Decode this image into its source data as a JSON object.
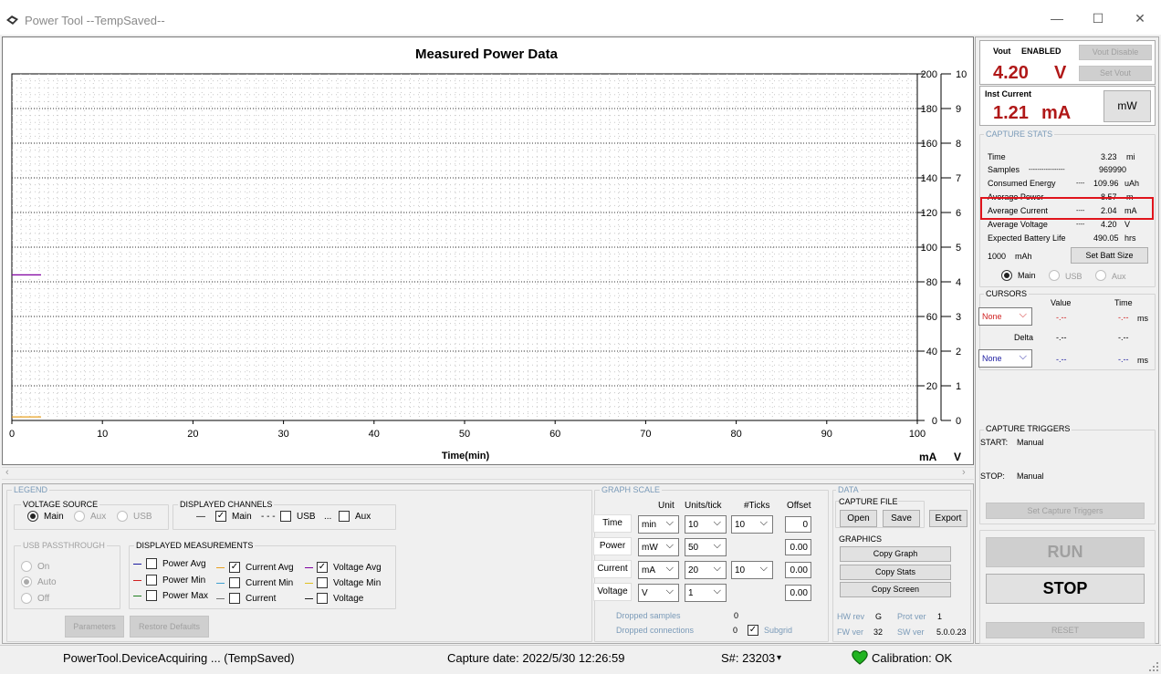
{
  "window": {
    "title": "Power Tool --TempSaved--",
    "minimize": "—",
    "maximize": "☐",
    "close": "✕"
  },
  "chart_data": {
    "type": "line",
    "title": "Measured Power Data",
    "xlabel": "Time(min)",
    "xlim": [
      0,
      100
    ],
    "x_ticks": [
      "0",
      "10",
      "20",
      "30",
      "40",
      "50",
      "60",
      "70",
      "80",
      "90",
      "100"
    ],
    "y_left_unit": "mA",
    "y_left_ylim": [
      0,
      200
    ],
    "y_left_ticks": [
      "0",
      "20",
      "40",
      "60",
      "80",
      "100",
      "120",
      "140",
      "160",
      "180",
      "200"
    ],
    "y_right_unit": "V",
    "y_right_ylim": [
      0,
      10
    ],
    "y_right_ticks": [
      "0",
      "1",
      "2",
      "3",
      "4",
      "5",
      "6",
      "7",
      "8",
      "9",
      "10"
    ],
    "grid": true,
    "series": [
      {
        "color": "#8000a0",
        "axis": "right",
        "x": [
          0,
          3.23
        ],
        "y": [
          4.2,
          4.2
        ]
      },
      {
        "color": "#e8a020",
        "axis": "left",
        "x": [
          0,
          3.23
        ],
        "y": [
          2.04,
          2.04
        ]
      }
    ]
  },
  "legend": {
    "title": "LEGEND",
    "voltage_source": {
      "title": "VOLTAGE SOURCE",
      "options": [
        "Main",
        "Aux",
        "USB"
      ],
      "selected": "Main"
    },
    "displayed_channels": {
      "title": "DISPLAYED CHANNELS",
      "main_line": "—",
      "main": "Main",
      "usb_line": "- - -",
      "usb": "USB",
      "aux_line": "...",
      "aux": "Aux"
    },
    "usb_passthrough": {
      "title": "USB PASSTHROUGH",
      "options": [
        "On",
        "Auto",
        "Off"
      ],
      "selected": "Auto"
    },
    "displayed_measurements": {
      "title": "DISPLAYED MEASUREMENTS",
      "power_avg": "Power Avg",
      "power_min": "Power Min",
      "power_max": "Power Max",
      "current_avg": "Current Avg",
      "current_min": "Current Min",
      "current": "Current",
      "voltage_avg": "Voltage Avg",
      "voltage_min": "Voltage Min",
      "voltage": "Voltage"
    },
    "parameters": "Parameters",
    "restore_defaults": "Restore Defaults"
  },
  "graph_scale": {
    "title": "GRAPH SCALE",
    "headers": {
      "unit": "Unit",
      "units_tick": "Units/tick",
      "ticks": "#Ticks",
      "offset": "Offset"
    },
    "rows": [
      {
        "label": "Time",
        "unit": "min",
        "units_tick": "10",
        "ticks": "10",
        "offset": "0"
      },
      {
        "label": "Power",
        "unit": "mW",
        "units_tick": "50",
        "ticks": "",
        "offset": "0.00"
      },
      {
        "label": "Current",
        "unit": "mA",
        "units_tick": "20",
        "ticks": "10",
        "offset": "0.00"
      },
      {
        "label": "Voltage",
        "unit": "V",
        "units_tick": "1",
        "ticks": "",
        "offset": "0.00"
      }
    ],
    "dropped_samples_label": "Dropped samples",
    "dropped_samples": "0",
    "dropped_connections_label": "Dropped connections",
    "dropped_connections": "0",
    "subgrid": "Subgrid"
  },
  "data": {
    "title": "DATA",
    "capture_file": "CAPTURE FILE",
    "open": "Open",
    "save": "Save",
    "export": "Export",
    "graphics": "GRAPHICS",
    "copy_graph": "Copy Graph",
    "copy_stats": "Copy Stats",
    "copy_screen": "Copy Screen",
    "hw_rev_label": "HW rev",
    "hw_rev": "G",
    "prot_ver_label": "Prot ver",
    "prot_ver": "1",
    "fw_ver_label": "FW ver",
    "fw_ver": "32",
    "sw_ver_label": "SW ver",
    "sw_ver": "5.0.0.23"
  },
  "vout": {
    "label": "Vout",
    "status": "ENABLED",
    "value": "4.20",
    "unit": "V",
    "disable_btn": "Vout Disable",
    "set_btn": "Set Vout"
  },
  "inst_current": {
    "label": "Inst Current",
    "value": "1.21",
    "unit": "mA",
    "toggle": "mW"
  },
  "capture_stats": {
    "title": "CAPTURE STATS",
    "rows": [
      {
        "label": "Time",
        "dots": "",
        "value": "3.23",
        "unit": "mi"
      },
      {
        "label": "Samples",
        "dots": "-----------------",
        "value": "969990",
        "unit": ""
      },
      {
        "label": "Consumed Energy",
        "dots": "----",
        "value": "109.96",
        "unit": "uAh"
      },
      {
        "label": "Average Power",
        "dots": "",
        "value": "8.57",
        "unit": "m"
      },
      {
        "label": "Average Current",
        "dots": "----",
        "value": "2.04",
        "unit": "mA"
      },
      {
        "label": "Average Voltage",
        "dots": "----",
        "value": "4.20",
        "unit": "V"
      },
      {
        "label": "Expected Battery Life",
        "dots": "",
        "value": "490.05",
        "unit": "hrs"
      }
    ],
    "batt_size": "1000",
    "batt_unit": "mAh",
    "set_batt": "Set Batt Size",
    "channels": [
      "Main",
      "USB",
      "Aux"
    ]
  },
  "cursors": {
    "title": "CURSORS",
    "value_header": "Value",
    "time_header": "Time",
    "c1": {
      "select": "None",
      "value": "-.--",
      "time": "-.--",
      "unit": "ms"
    },
    "delta": {
      "label": "Delta",
      "value": "-.--",
      "time": "-.--"
    },
    "c2": {
      "select": "None",
      "value": "-.--",
      "time": "-.--",
      "unit": "ms"
    }
  },
  "triggers": {
    "title": "CAPTURE TRIGGERS",
    "start_label": "START:",
    "start": "Manual",
    "stop_label": "STOP:",
    "stop": "Manual",
    "set_btn": "Set Capture Triggers"
  },
  "controls": {
    "run": "RUN",
    "stop": "STOP",
    "reset": "RESET"
  },
  "status": {
    "state": "PowerTool.DeviceAcquiring ... (TempSaved)",
    "capture_date": "Capture date: 2022/5/30 12:26:59",
    "serial": "S#: 23203",
    "serial_caret": "▾",
    "calibration": "Calibration: OK"
  },
  "colors": {
    "accent_red": "#b01818",
    "highlight": "#e0141c",
    "power": "#1a1aa0",
    "current": "#e8a020",
    "voltage": "#8000a0",
    "heart": "#22b422"
  }
}
